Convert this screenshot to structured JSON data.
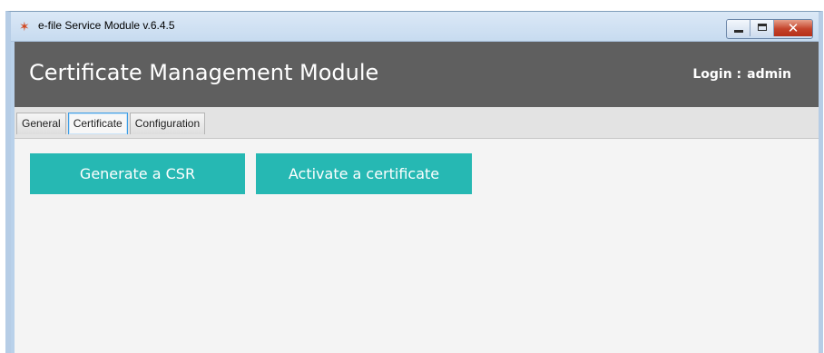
{
  "window": {
    "title": "e-file Service Module v.6.4.5",
    "controls": {
      "minimize_icon": "minimize-icon",
      "maximize_icon": "maximize-icon",
      "close_icon": "close-icon",
      "close_glyph": "✕"
    }
  },
  "header": {
    "title": "Certificate Management Module",
    "login_label": "Login :",
    "login_user": "admin"
  },
  "tabs": [
    {
      "label": "General",
      "active": false
    },
    {
      "label": "Certificate",
      "active": true
    },
    {
      "label": "Configuration",
      "active": false
    }
  ],
  "actions": {
    "generate_csr": "Generate a CSR",
    "activate_certificate": "Activate a certificate"
  },
  "colors": {
    "header_bg": "#5f5f5f",
    "accent_button": "#26b8b3",
    "active_tab_border": "#3f9ee5"
  }
}
